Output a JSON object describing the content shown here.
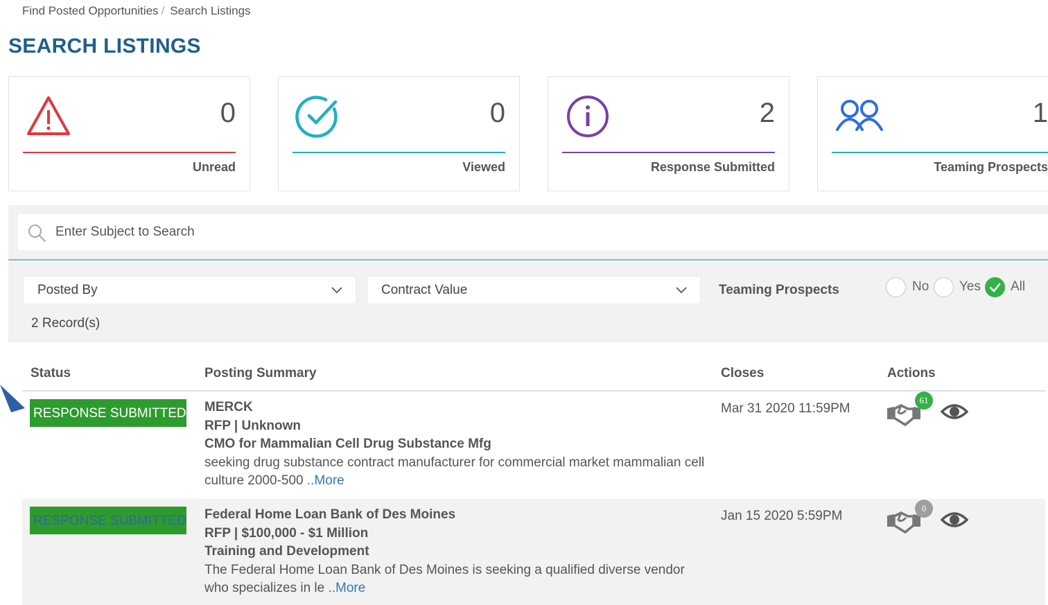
{
  "breadcrumb": {
    "items": [
      "Find Posted Opportunities",
      "Search Listings"
    ],
    "separator": "/"
  },
  "page_title": "SEARCH LISTINGS",
  "cards": [
    {
      "count": "0",
      "label": "Unread",
      "icon": "warning-triangle-icon",
      "color": "#e0383e"
    },
    {
      "count": "0",
      "label": "Viewed",
      "icon": "check-circle-icon",
      "color": "#1fb0c4"
    },
    {
      "count": "2",
      "label": "Response Submitted",
      "icon": "info-circle-icon",
      "color": "#7b3fa6"
    },
    {
      "count": "1",
      "label": "Teaming Prospects",
      "icon": "users-icon",
      "color": "#2e6fd9"
    }
  ],
  "search": {
    "placeholder": "Enter Subject to Search",
    "value": ""
  },
  "filters": {
    "posted_by": "Posted By",
    "contract_value": "Contract Value",
    "teaming_label": "Teaming Prospects",
    "options": [
      "No",
      "Yes",
      "All"
    ],
    "selected": "All"
  },
  "records": "2 Record(s)",
  "table": {
    "headers": [
      "Status",
      "Posting Summary",
      "Closes",
      "Actions"
    ],
    "rows": [
      {
        "status": "RESPONSE SUBMITTED",
        "org": "MERCK",
        "type": "RFP | Unknown",
        "title": "CMO for Mammalian Cell Drug Substance Mfg",
        "desc": "seeking drug substance contract manufacturer for commercial market mammalian cell culture 2000-500",
        "more": "..More",
        "closes": "Mar 31 2020 11:59PM",
        "teaming_count": "61"
      },
      {
        "status": "RESPONSE SUBMITTED",
        "org": "Federal Home Loan Bank of Des Moines",
        "type": "RFP | $100,000 - $1 Million",
        "title": "Training and Development",
        "desc": "The Federal Home Loan Bank of Des Moines is seeking a qualified diverse vendor who specializes in le",
        "more": "..More",
        "closes": "Jan 15 2020 5:59PM",
        "teaming_count": "0"
      }
    ]
  },
  "colors": {
    "title": "#1f5f8b",
    "badge": "#2e9b2e",
    "link": "#2f79b5",
    "accent_rule": "#7fb2d3",
    "count_active": "#35b04a",
    "count_zero": "#9e9e9e"
  }
}
